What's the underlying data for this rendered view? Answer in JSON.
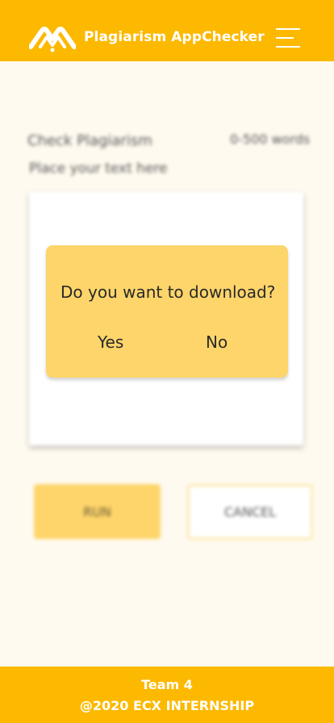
{
  "header": {
    "title": "Plagiarism AppChecker",
    "logo_icon": "mountain-logo-icon",
    "menu_icon": "hamburger-menu-icon",
    "background_color": "#fcb900"
  },
  "main": {
    "section_title": "Check Plagiarism",
    "word_limit": "0-500 words",
    "hint": "Place your text here",
    "text_value": "",
    "run_label": "RUN",
    "cancel_label": "CANCEL"
  },
  "dialog": {
    "question": "Do you want to download?",
    "yes_label": "Yes",
    "no_label": "No",
    "background_color": "#fdd56a"
  },
  "footer": {
    "team": "Team 4",
    "copyright": "@2020 ECX INTERNSHIP"
  }
}
